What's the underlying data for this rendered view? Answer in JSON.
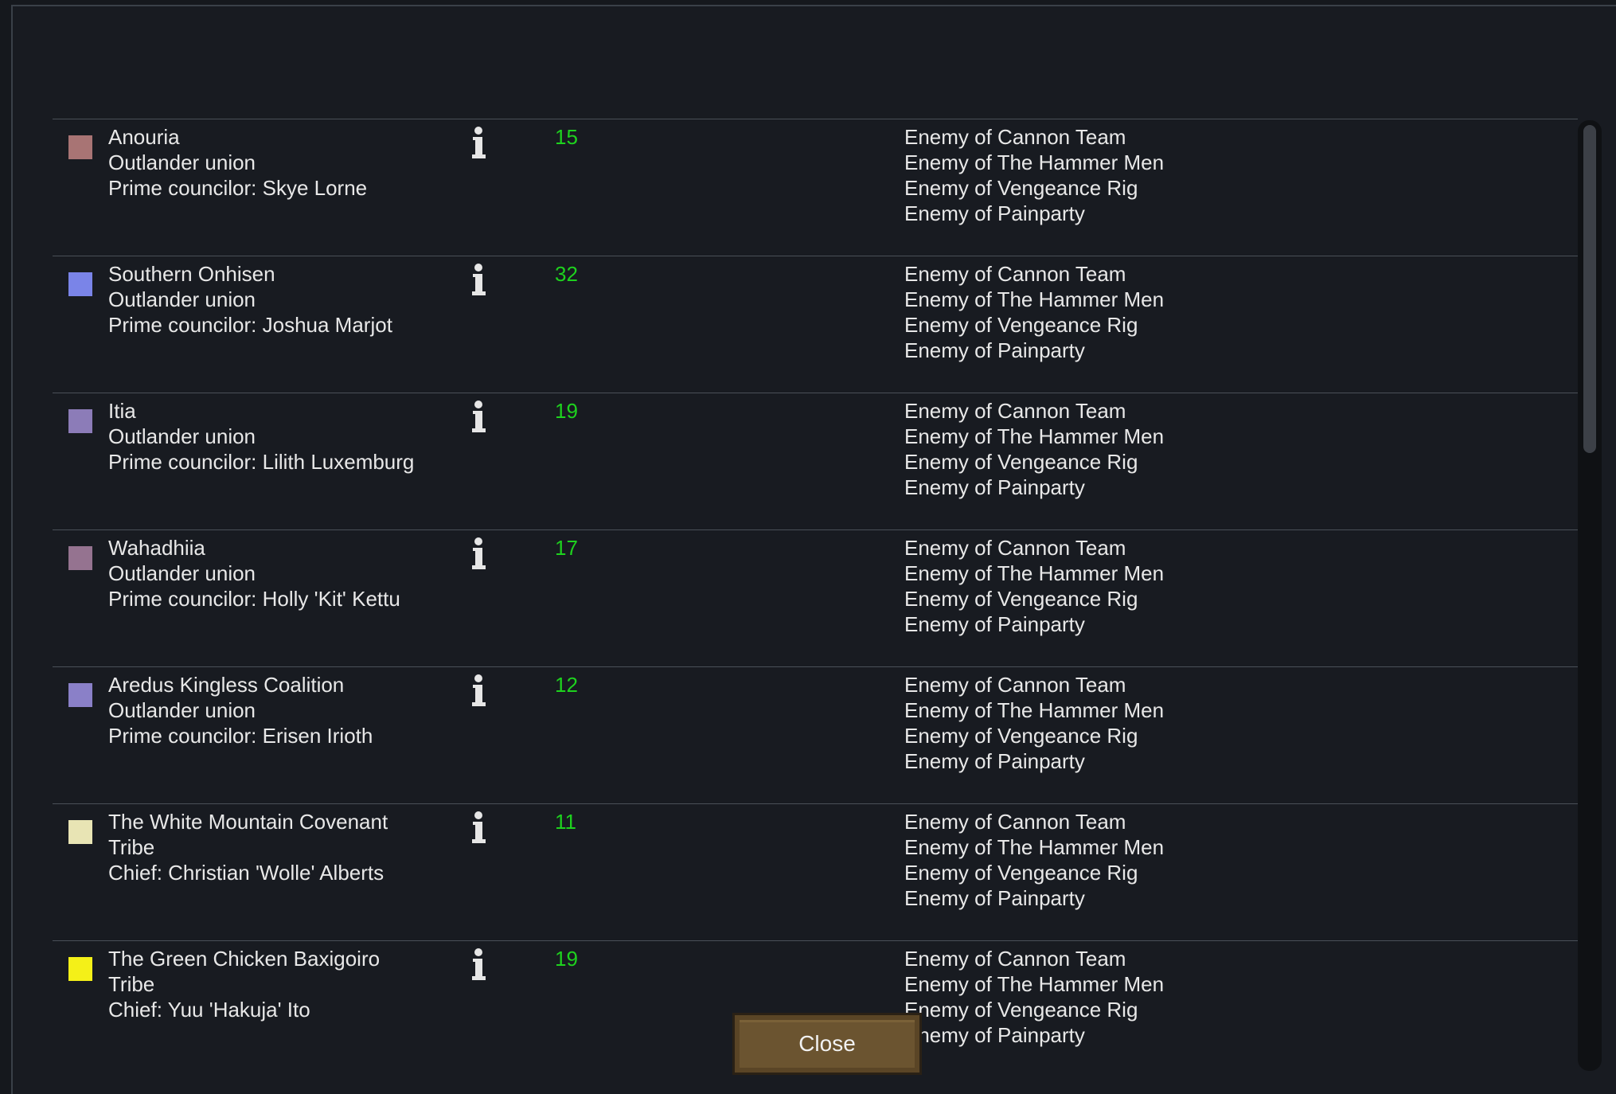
{
  "close_label": "Close",
  "factions": [
    {
      "name": "Anouria",
      "type": "Outlander union",
      "leader": "Prime councilor: Skye Lorne",
      "count": "15",
      "color": "#a87474",
      "relations": [
        "Enemy of Cannon Team",
        "Enemy of The Hammer Men",
        "Enemy of Vengeance Rig",
        "Enemy of Painparty"
      ]
    },
    {
      "name": "Southern Onhisen",
      "type": "Outlander union",
      "leader": "Prime councilor: Joshua Marjot",
      "count": "32",
      "color": "#7a84e8",
      "relations": [
        "Enemy of Cannon Team",
        "Enemy of The Hammer Men",
        "Enemy of Vengeance Rig",
        "Enemy of Painparty"
      ]
    },
    {
      "name": "Itia",
      "type": "Outlander union",
      "leader": "Prime councilor: Lilith Luxemburg",
      "count": "19",
      "color": "#8c7cb8",
      "relations": [
        "Enemy of Cannon Team",
        "Enemy of The Hammer Men",
        "Enemy of Vengeance Rig",
        "Enemy of Painparty"
      ]
    },
    {
      "name": "Wahadhiia",
      "type": "Outlander union",
      "leader": "Prime councilor: Holly 'Kit' Kettu",
      "count": "17",
      "color": "#957390",
      "relations": [
        "Enemy of Cannon Team",
        "Enemy of The Hammer Men",
        "Enemy of Vengeance Rig",
        "Enemy of Painparty"
      ]
    },
    {
      "name": "Aredus Kingless Coalition",
      "type": "Outlander union",
      "leader": "Prime councilor: Erisen Irioth",
      "count": "12",
      "color": "#8a80c8",
      "relations": [
        "Enemy of Cannon Team",
        "Enemy of The Hammer Men",
        "Enemy of Vengeance Rig",
        "Enemy of Painparty"
      ]
    },
    {
      "name": "The White Mountain Covenant",
      "type": "Tribe",
      "leader": "Chief: Christian 'Wolle' Alberts",
      "count": "11",
      "color": "#e8e4b4",
      "relations": [
        "Enemy of Cannon Team",
        "Enemy of The Hammer Men",
        "Enemy of Vengeance Rig",
        "Enemy of Painparty"
      ]
    },
    {
      "name": "The Green Chicken Baxigoiro",
      "type": "Tribe",
      "leader": "Chief: Yuu 'Hakuja' Ito",
      "count": "19",
      "color": "#f4f018",
      "relations": [
        "Enemy of Cannon Team",
        "Enemy of The Hammer Men",
        "Enemy of Vengeance Rig",
        "Enemy of Painparty"
      ]
    }
  ]
}
